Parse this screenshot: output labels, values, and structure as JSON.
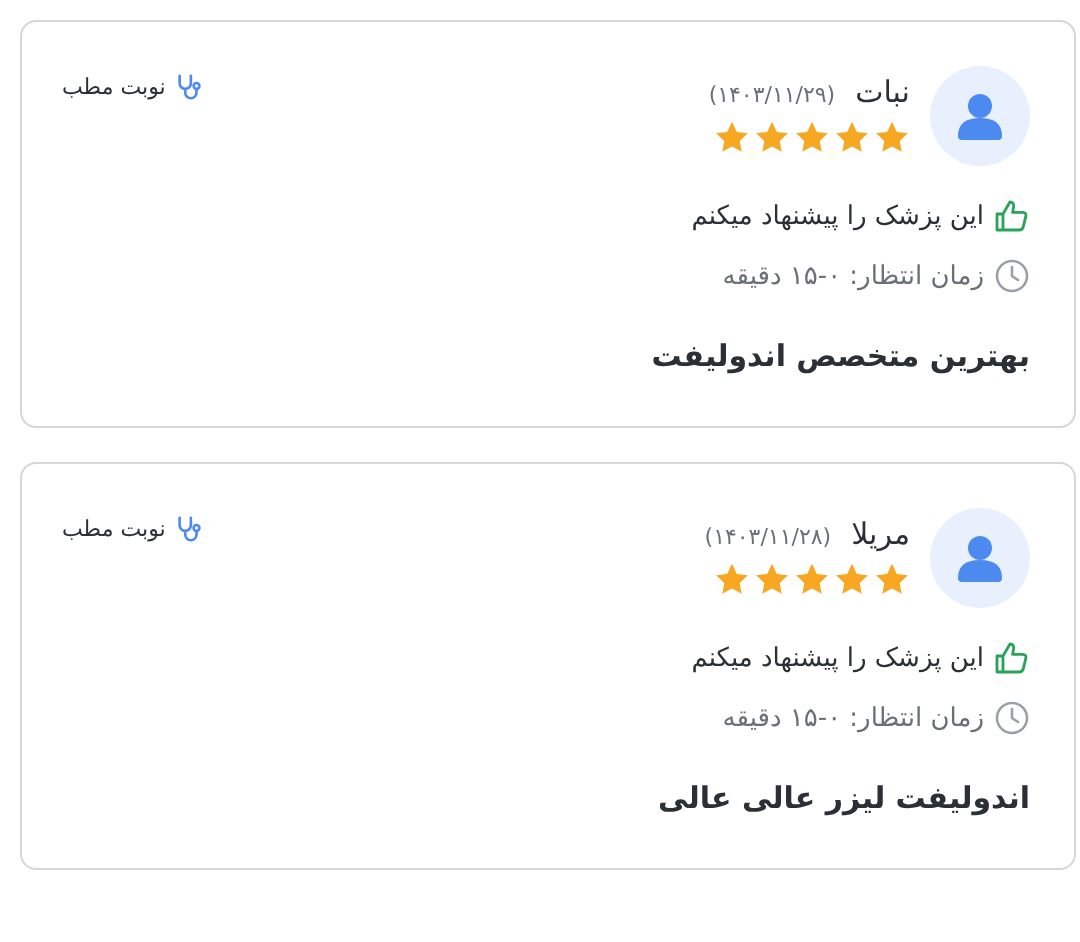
{
  "reviews": [
    {
      "name": "نبات",
      "date": "(۱۴۰۳/۱۱/۲۹)",
      "stars": 5,
      "visit_type": "نوبت مطب",
      "recommendation": "این پزشک را پیشنهاد میکنم",
      "wait_time": "زمان انتظار: ۰-۱۵ دقیقه",
      "comment": "بهترین متخصص اندولیفت"
    },
    {
      "name": "مریلا",
      "date": "(۱۴۰۳/۱۱/۲۸)",
      "stars": 5,
      "visit_type": "نوبت مطب",
      "recommendation": "این پزشک را پیشنهاد میکنم",
      "wait_time": "زمان انتظار: ۰-۱۵ دقیقه",
      "comment": "اندولیفت لیزر عالی عالی"
    }
  ]
}
